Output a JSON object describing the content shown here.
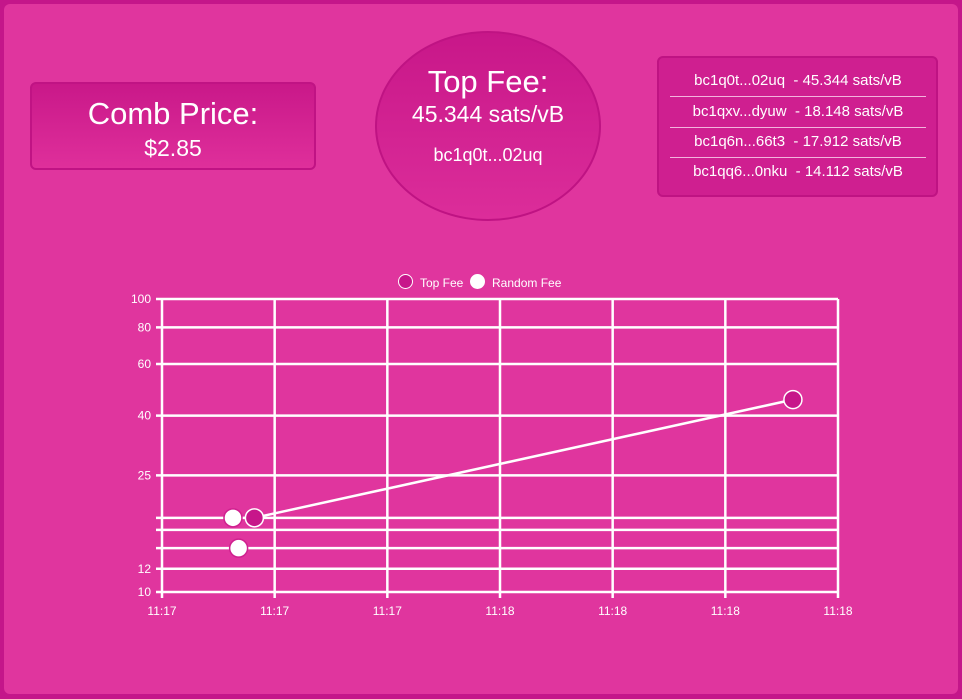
{
  "price_card": {
    "title": "Comb Price:",
    "value": "$2.85"
  },
  "top_fee_card": {
    "title": "Top Fee:",
    "value": "45.344 sats/vB",
    "address": "bc1q0t...02uq"
  },
  "fee_list": [
    {
      "address": "bc1q0t...02uq",
      "fee": "- 45.344 sats/vB"
    },
    {
      "address": "bc1qxv...dyuw",
      "fee": "- 18.148 sats/vB"
    },
    {
      "address": "bc1q6n...66t3",
      "fee": "- 17.912 sats/vB"
    },
    {
      "address": "bc1qq6...0nku",
      "fee": "- 14.112 sats/vB"
    }
  ],
  "colors": {
    "background": "#e0359e",
    "top_fee": "#c7168a",
    "random_fee": "#ffffff",
    "grid": "#ffffff"
  },
  "chart_data": {
    "type": "scatter",
    "yscale": "log",
    "ylim": [
      10,
      100
    ],
    "y_ticks": [
      10,
      12,
      25,
      40,
      60,
      80,
      100
    ],
    "y_tick_labels": [
      "10",
      "12",
      "25",
      "40",
      "60",
      "80",
      "100"
    ],
    "y_extra_gridlines": [
      14.112,
      16.3,
      17.912
    ],
    "x_tick_labels": [
      "11:17",
      "11:17",
      "11:17",
      "11:18",
      "11:18",
      "11:18",
      "11:18"
    ],
    "xlim": [
      0,
      6
    ],
    "legend_position": "top-center",
    "series": [
      {
        "name": "Top Fee",
        "color": "#c7168a",
        "show_line": true,
        "points": [
          {
            "x": 0.82,
            "y": 17.912
          },
          {
            "x": 5.6,
            "y": 45.344
          }
        ]
      },
      {
        "name": "Random Fee",
        "color": "#ffffff",
        "show_line": false,
        "points": [
          {
            "x": 0.63,
            "y": 17.912
          },
          {
            "x": 0.68,
            "y": 14.112
          }
        ]
      }
    ]
  }
}
